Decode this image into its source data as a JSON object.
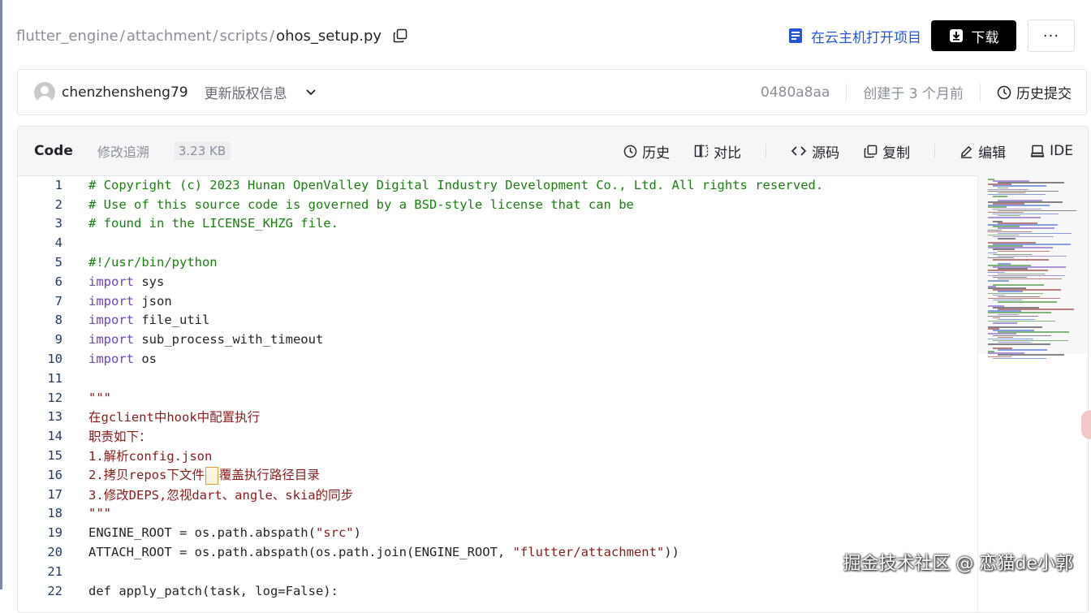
{
  "breadcrumb": {
    "items": [
      "flutter_engine",
      "attachment",
      "scripts"
    ],
    "current": "ohos_setup.py",
    "separator": "/"
  },
  "top_actions": {
    "open_cloud": "在云主机打开项目",
    "download": "下载",
    "more": "···"
  },
  "commit": {
    "author": "chenzhensheng79",
    "message": "更新版权信息",
    "hash": "0480a8aa",
    "created": "创建于 3 个月前",
    "history": "历史提交"
  },
  "file": {
    "tab_code": "Code",
    "tab_blame": "修改追溯",
    "size": "3.23 KB",
    "actions": {
      "history": "历史",
      "compare": "对比",
      "source": "源码",
      "copy": "复制",
      "edit": "编辑",
      "ide": "IDE"
    }
  },
  "code_lines": [
    {
      "n": "1",
      "text": "# Copyright (c) 2023 Hunan OpenValley Digital Industry Development Co., Ltd. All rights reserved."
    },
    {
      "n": "2",
      "text": "# Use of this source code is governed by a BSD-style license that can be"
    },
    {
      "n": "3",
      "text": "# found in the LICENSE_KHZG file."
    },
    {
      "n": "4",
      "text": ""
    },
    {
      "n": "5",
      "text": "#!/usr/bin/python"
    },
    {
      "n": "6",
      "kw": "import",
      "text": " sys"
    },
    {
      "n": "7",
      "kw": "import",
      "text": " json"
    },
    {
      "n": "8",
      "kw": "import",
      "text": " file_util"
    },
    {
      "n": "9",
      "kw": "import",
      "text": " sub_process_with_timeout"
    },
    {
      "n": "10",
      "kw": "import",
      "text": " os"
    },
    {
      "n": "11",
      "text": ""
    },
    {
      "n": "12",
      "text": "\"\"\""
    },
    {
      "n": "13",
      "text": "在gclient中hook中配置执行"
    },
    {
      "n": "14",
      "text": "职责如下："
    },
    {
      "n": "15",
      "text": "1.解析config.json"
    },
    {
      "n": "16",
      "text_a": "2.拷贝repos下文件",
      "text_b": "覆盖执行路径目录"
    },
    {
      "n": "17",
      "text": "3.修改DEPS,忽视dart、angle、skia的同步"
    },
    {
      "n": "18",
      "text": "\"\"\""
    },
    {
      "n": "19",
      "pre": "ENGINE_ROOT = os.path.abspath(",
      "str": "\"src\"",
      "post": ")"
    },
    {
      "n": "20",
      "pre": "ATTACH_ROOT = os.path.abspath(os.path.join(ENGINE_ROOT, ",
      "str": "\"flutter/attachment\"",
      "post": "))"
    },
    {
      "n": "21",
      "text": ""
    },
    {
      "n": "22",
      "text": "def apply_patch(task, log=False):"
    }
  ],
  "watermark": "掘金技术社区 @ 恋猫de小郭",
  "colors": {
    "comment": "#18800f",
    "keyword": "#6f42c1",
    "string": "#8b1a1a",
    "link": "#2556d6",
    "download_bg": "#000000"
  }
}
